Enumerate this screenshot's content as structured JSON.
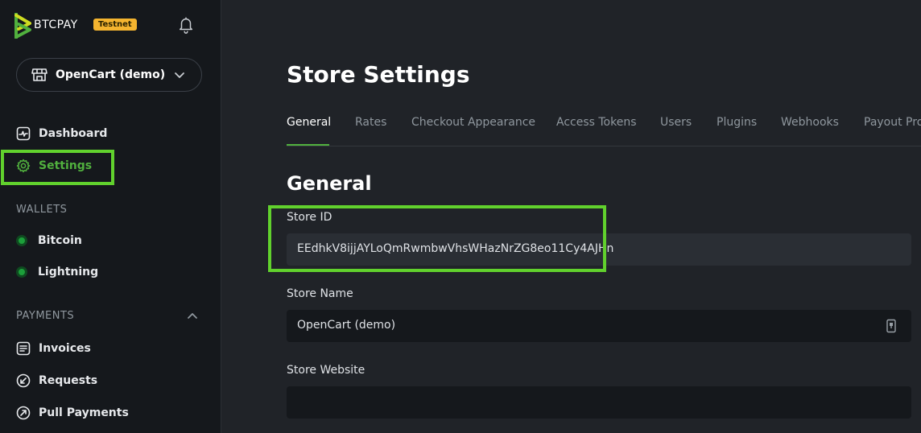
{
  "brand": {
    "name": "BTCPAY",
    "badge": "Testnet"
  },
  "store_switcher": {
    "label": "OpenCart (demo)"
  },
  "sidebar": {
    "nav": [
      {
        "label": "Dashboard",
        "icon": "dashboard-icon"
      },
      {
        "label": "Settings",
        "icon": "gear-icon",
        "active": true
      }
    ],
    "wallets_label": "WALLETS",
    "wallets": [
      {
        "label": "Bitcoin",
        "status": "connected"
      },
      {
        "label": "Lightning",
        "status": "connected"
      }
    ],
    "payments_label": "PAYMENTS",
    "payments": [
      {
        "label": "Invoices",
        "icon": "invoice-icon"
      },
      {
        "label": "Requests",
        "icon": "request-icon"
      },
      {
        "label": "Pull Payments",
        "icon": "pull-payment-icon"
      }
    ]
  },
  "main": {
    "title": "Store Settings",
    "tabs": [
      {
        "label": "General",
        "active": true
      },
      {
        "label": "Rates"
      },
      {
        "label": "Checkout Appearance"
      },
      {
        "label": "Access Tokens"
      },
      {
        "label": "Users"
      },
      {
        "label": "Plugins"
      },
      {
        "label": "Webhooks"
      },
      {
        "label": "Payout Pro"
      }
    ],
    "section_title": "General",
    "fields": {
      "store_id": {
        "label": "Store ID",
        "value": "EEdhkV8ijjAYLoQmRwmbwVhsWHazNrZG8eo11Cy4AJHn"
      },
      "store_name": {
        "label": "Store Name",
        "value": "OpenCart (demo)"
      },
      "store_website": {
        "label": "Store Website",
        "value": ""
      }
    }
  },
  "colors": {
    "accent": "#51b13e",
    "highlight": "#61d12d",
    "badge": "#f4b42f",
    "status_dot": "#1c9f3a"
  }
}
